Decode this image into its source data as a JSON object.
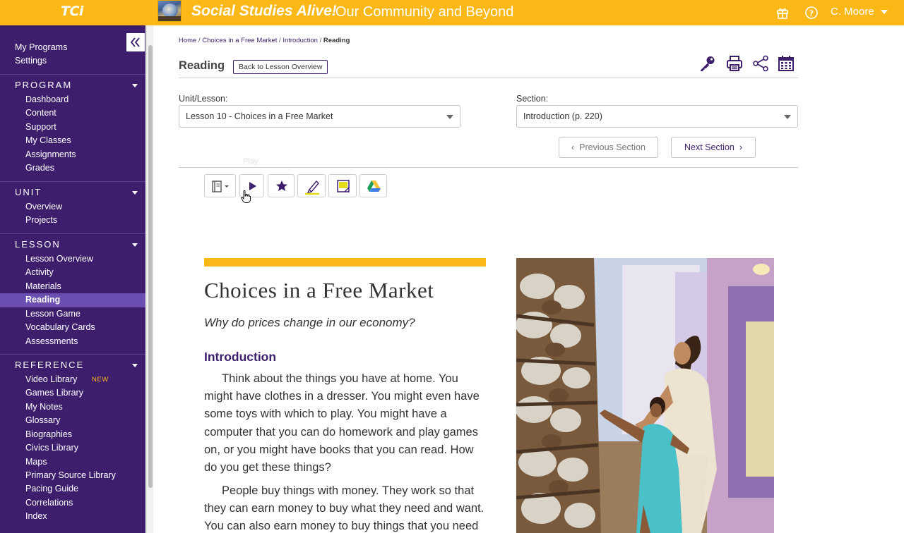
{
  "header": {
    "logo": "TCi",
    "program_title": "Social Studies Alive!",
    "program_subtitle": "Our Community and Beyond",
    "user_name": "C. Moore"
  },
  "sidebar": {
    "top_links": [
      "My Programs",
      "Settings"
    ],
    "sections": [
      {
        "title": "PROGRAM",
        "items": [
          "Dashboard",
          "Content",
          "Support",
          "My Classes",
          "Assignments",
          "Grades"
        ]
      },
      {
        "title": "UNIT",
        "items": [
          "Overview",
          "Projects"
        ]
      },
      {
        "title": "LESSON",
        "items": [
          "Lesson Overview",
          "Activity",
          "Materials",
          "Reading",
          "Lesson Game",
          "Vocabulary Cards",
          "Assessments"
        ],
        "active": "Reading"
      },
      {
        "title": "REFERENCE",
        "items": [
          "Video Library",
          "Games Library",
          "My Notes",
          "Glossary",
          "Biographies",
          "Civics Library",
          "Maps",
          "Primary Source Library",
          "Pacing Guide",
          "Correlations",
          "Index"
        ],
        "badge": "NEW"
      }
    ]
  },
  "breadcrumb": {
    "items": [
      "Home",
      "Choices in a Free Market",
      "Introduction"
    ],
    "current": "Reading"
  },
  "page": {
    "title": "Reading",
    "back_button": "Back to Lesson Overview"
  },
  "selectors": {
    "unit_label": "Unit/Lesson:",
    "unit_value": "Lesson 10 - Choices in a Free Market",
    "section_label": "Section:",
    "section_value": "Introduction (p. 220)"
  },
  "section_nav": {
    "prev_label": "Previous Section",
    "next_label": "Next Section"
  },
  "reader_toolbar": {
    "tooltip": "Play"
  },
  "reading": {
    "title": "Choices in a Free Market",
    "essential_question": "Why do prices change in our economy?",
    "section_heading": "Introduction",
    "paragraphs": [
      "Think about the things you have at home. You might have clothes in a dresser. You might even have some toys with which to play. You might have a computer that you can do homework and play games on, or you might have books that you can read. How do you get these things?",
      "People buy things with money. They work so that they can earn money to buy what they need and want. You can also earn money to buy things that you need"
    ]
  },
  "colors": {
    "brand_yellow": "#fbb817",
    "sidebar_purple": "#3d1e6d",
    "active_item": "#6b4fb0"
  }
}
